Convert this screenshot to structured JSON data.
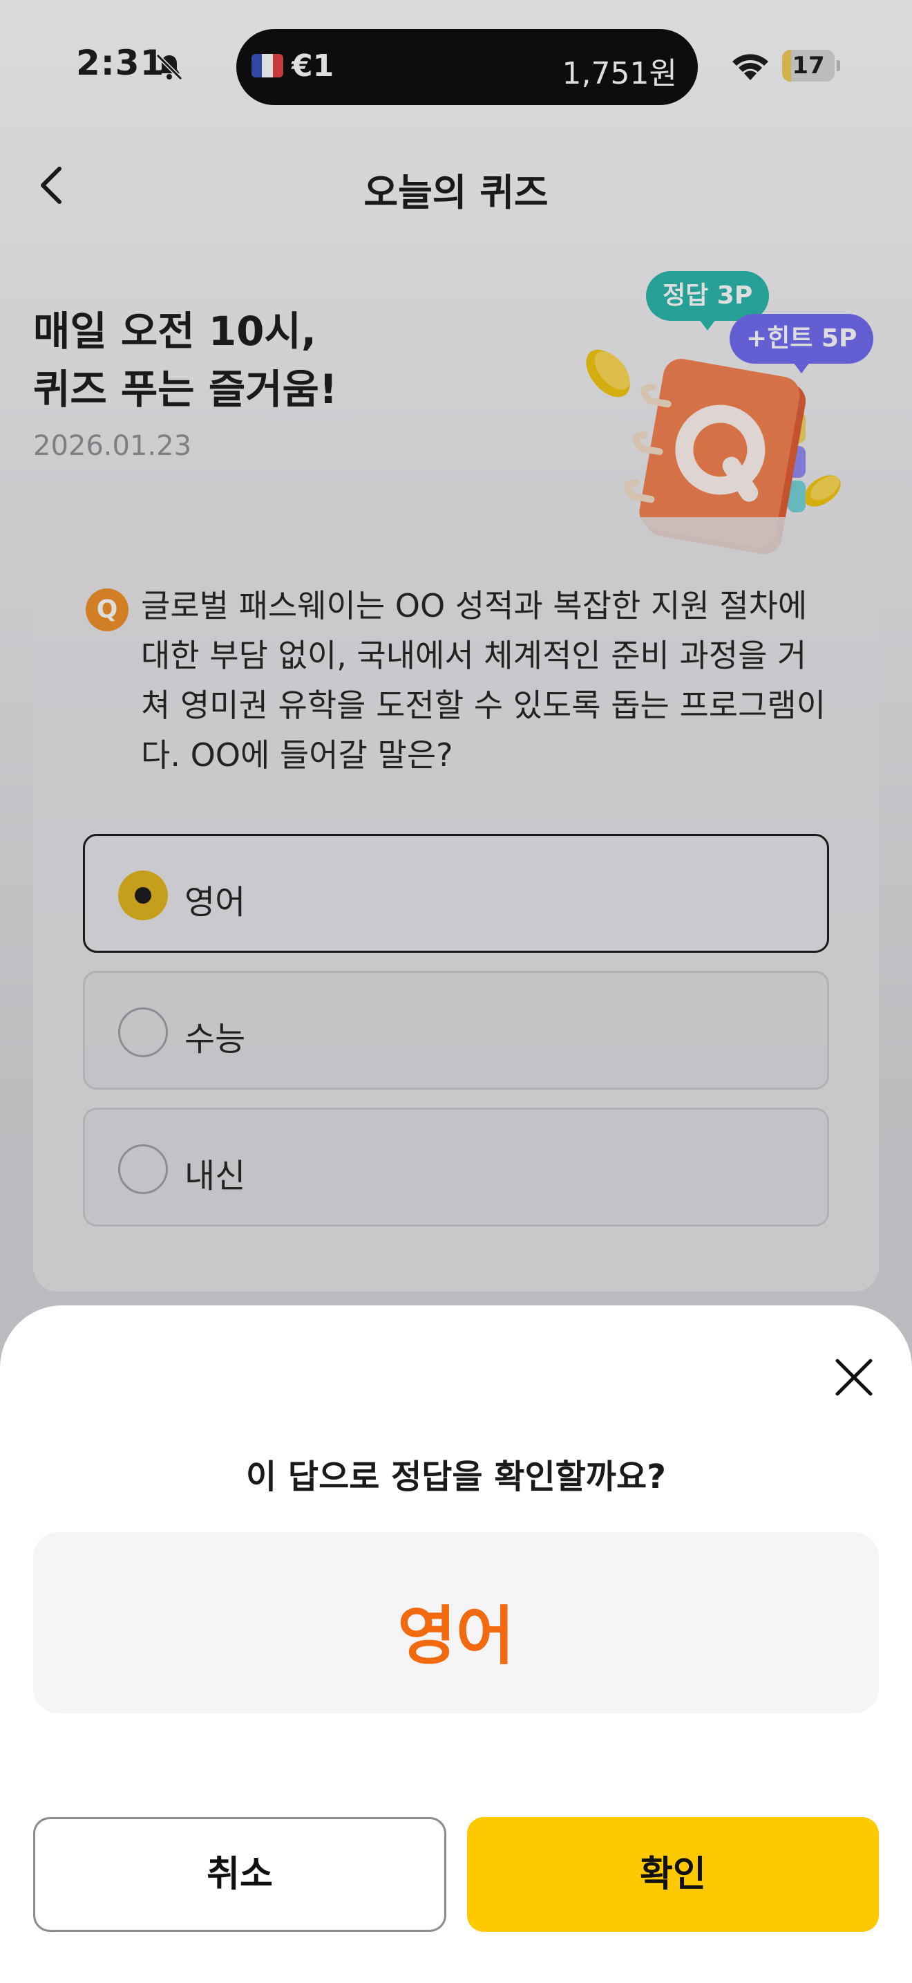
{
  "status_bar": {
    "time": "2:31",
    "island_left": "€1",
    "island_right": "1,751원",
    "battery": "17",
    "battery_level": 0.17,
    "icons": [
      "bell-slash-icon",
      "france-flag-icon",
      "wifi-icon",
      "battery-icon"
    ]
  },
  "header": {
    "title": "오늘의 퀴즈",
    "back_icon": "chevron-left-icon"
  },
  "hero": {
    "line1": "매일 오전 10시,",
    "line2": "퀴즈 푸는 즐거움!",
    "date": "2026.01.23",
    "badge_correct": "정답 3P",
    "badge_hint": "+힌트 5P",
    "illustration": "quiz-notebook-icon"
  },
  "quiz": {
    "q_icon_label": "Q",
    "question": "글로벌 패스웨이는 OO 성적과 복잡한 지원 절차에 대한 부담 없이, 국내에서 체계적인 준비 과정을 거쳐 영미권 유학을 도전할 수 있도록 돕는 프로그램이다. OO에 들어갈 말은?",
    "options": [
      {
        "label": "영어",
        "selected": true
      },
      {
        "label": "수능",
        "selected": false
      },
      {
        "label": "내신",
        "selected": false
      }
    ]
  },
  "sheet": {
    "prompt": "이 답으로 정답을 확인할까요?",
    "answer": "영어",
    "cancel_label": "취소",
    "confirm_label": "확인",
    "close_icon": "close-icon"
  },
  "colors": {
    "accent_yellow": "#fec900",
    "answer_orange": "#f26a0f",
    "badge_teal": "#1fb2a6",
    "badge_purple": "#6a63f0",
    "q_orange": "#f08a1c"
  }
}
